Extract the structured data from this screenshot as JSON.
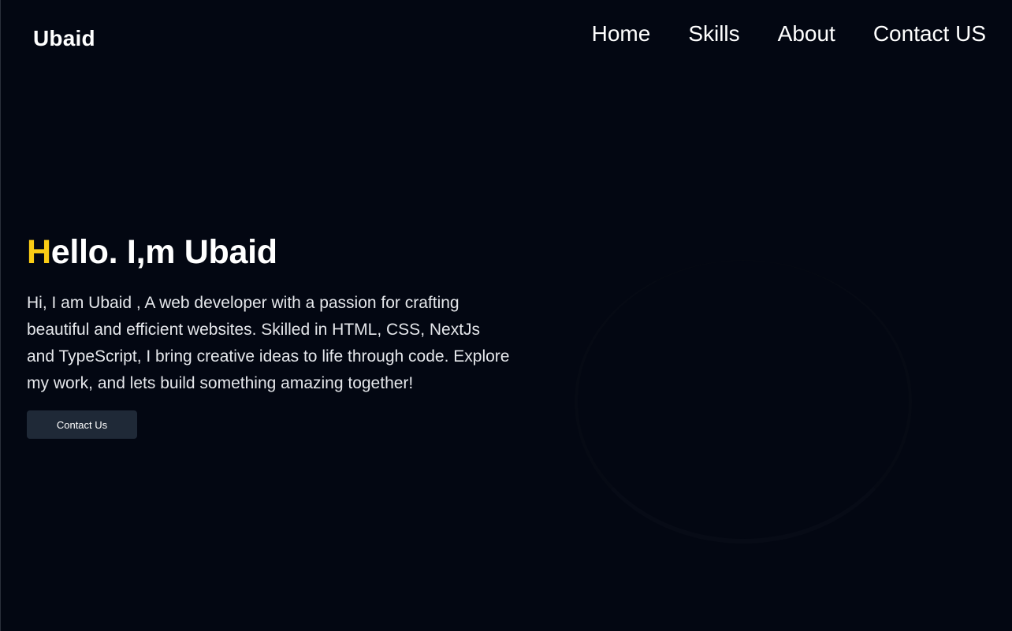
{
  "navbar": {
    "brand": "Ubaid",
    "links": [
      {
        "label": "Home"
      },
      {
        "label": "Skills"
      },
      {
        "label": "About"
      },
      {
        "label": "Contact US"
      }
    ]
  },
  "hero": {
    "title_first_letter": "H",
    "title_rest": "ello. I,m Ubaid",
    "description": "Hi, I am Ubaid , A web developer with a passion for crafting beautiful and efficient websites. Skilled in HTML, CSS, NextJs and TypeScript, I bring creative ideas to life through code. Explore my work, and lets build something amazing together!",
    "cta_label": "Contact Us"
  },
  "colors": {
    "background": "#030712",
    "accent": "#facc15",
    "button": "#1f2937"
  }
}
